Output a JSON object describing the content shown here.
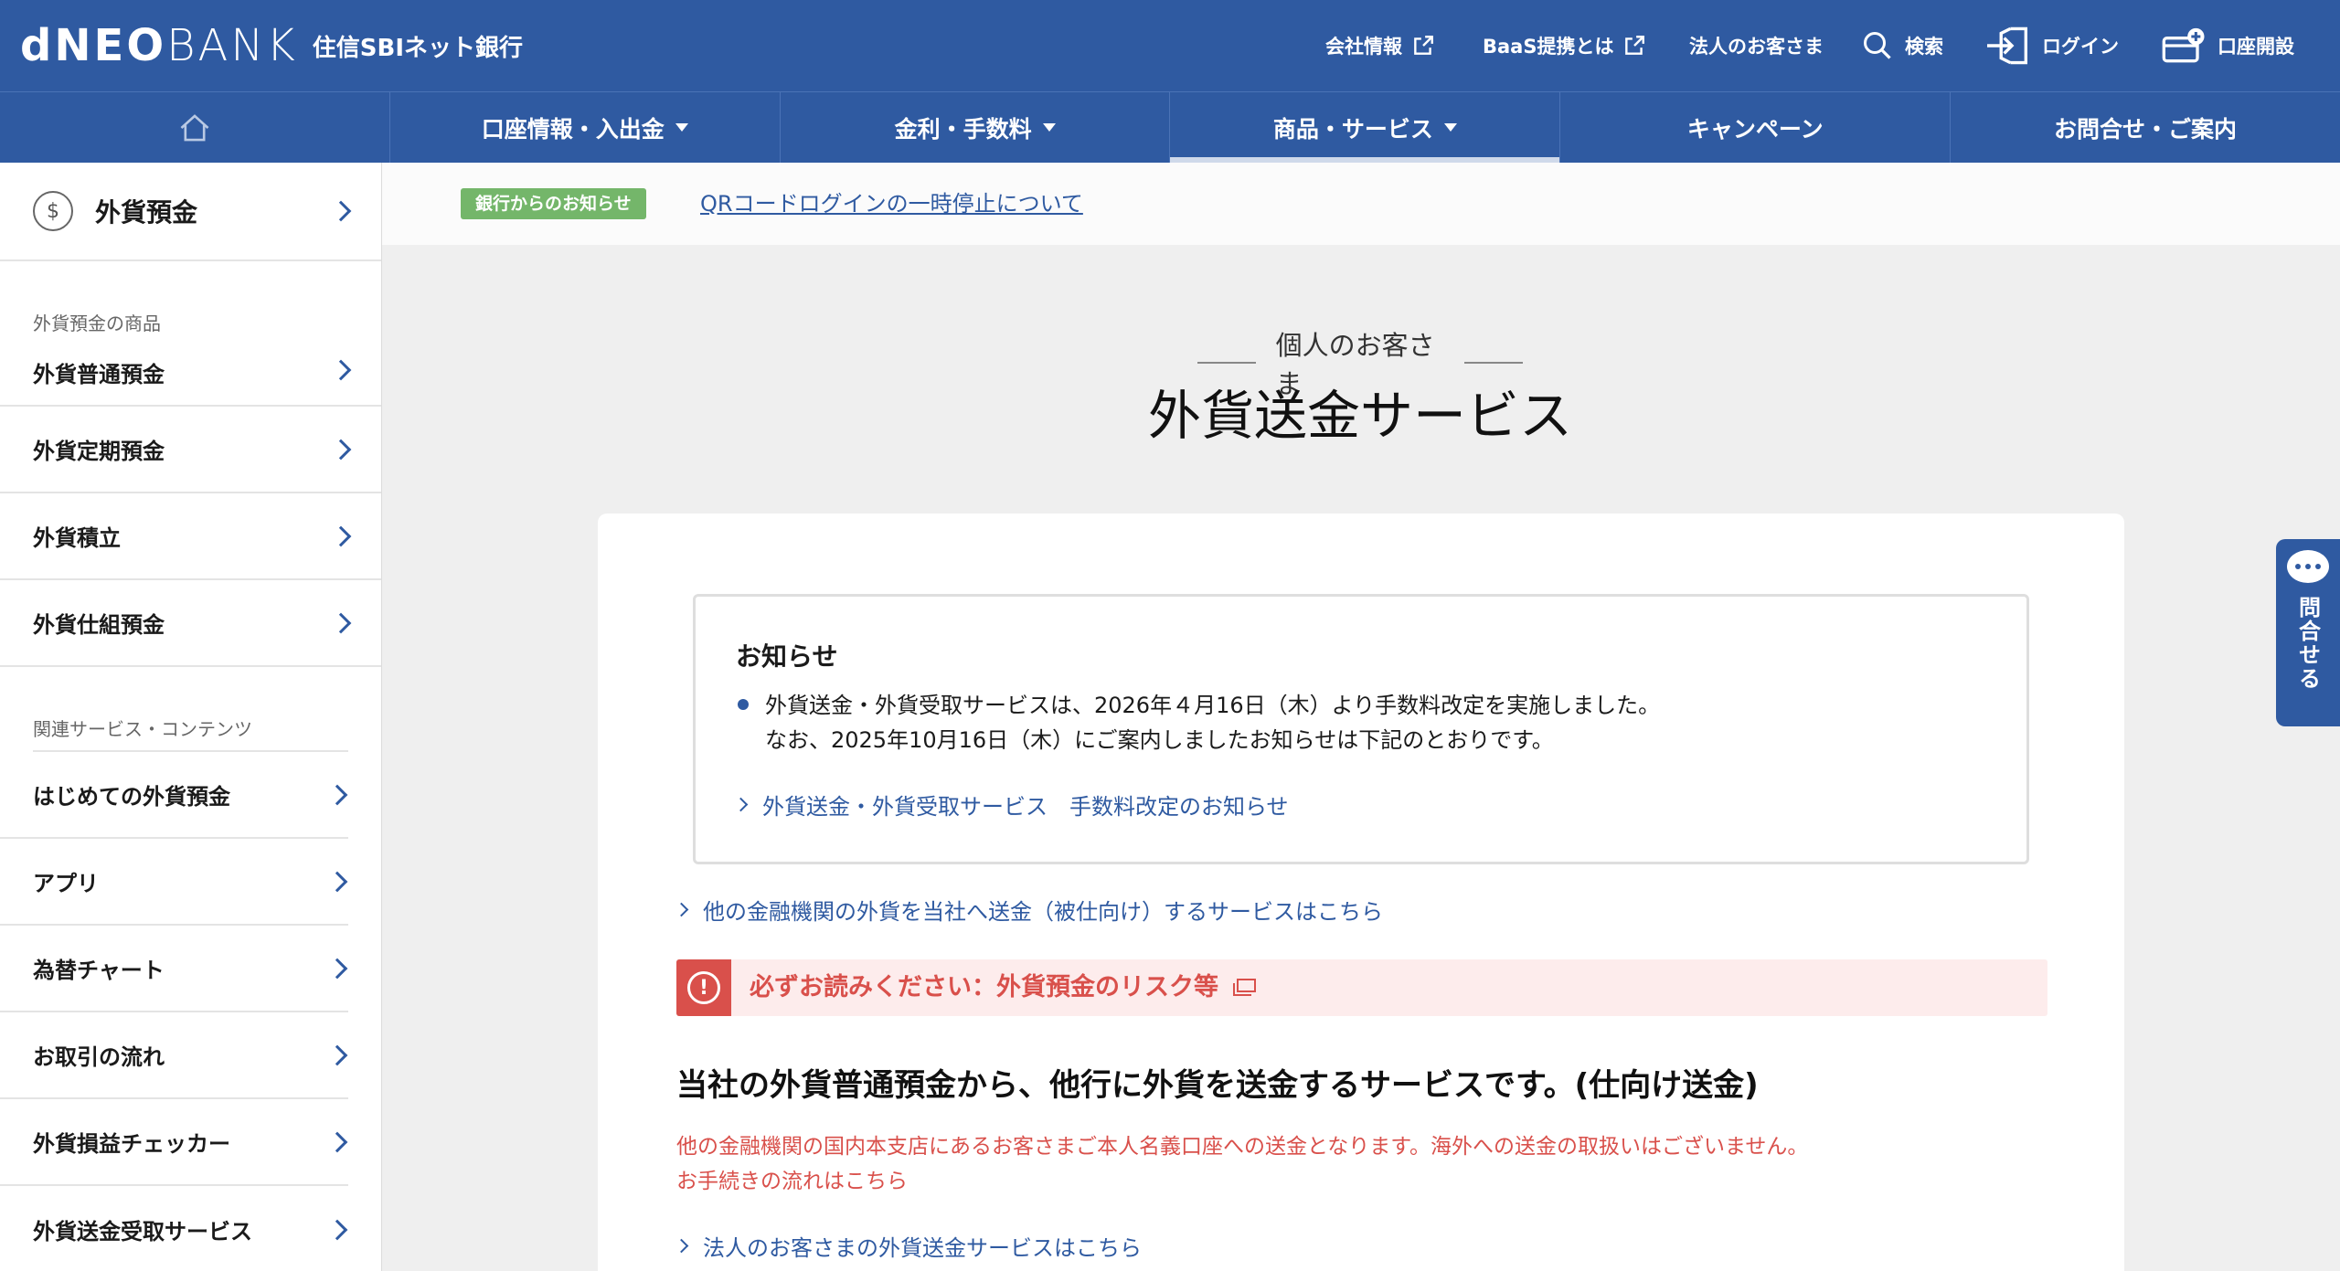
{
  "header": {
    "logo_brand": "NEO",
    "logo_d": "d",
    "logo_bank": "BANK",
    "logo_sub": "住信SBIネット銀行",
    "util": [
      {
        "label": "会社情報",
        "icon": "external-link-icon"
      },
      {
        "label": "BaaS提携とは",
        "icon": "external-link-icon"
      },
      {
        "label": "法人のお客さま"
      },
      {
        "label": "検索",
        "icon": "search-icon"
      },
      {
        "label": "ログイン",
        "icon": "login-icon"
      },
      {
        "label": "口座開設",
        "icon": "card-plus-icon"
      }
    ]
  },
  "nav": {
    "home_icon": "home-icon",
    "items": [
      "口座情報・入出金",
      "金利・手数料",
      "商品・サービス",
      "キャンペーン",
      "お問合せ・ご案内"
    ]
  },
  "sidebar": {
    "head": "外貨預金",
    "coin_symbol": "$",
    "products_caption": "外貨預金の商品",
    "products": [
      "外貨普通預金",
      "外貨定期預金",
      "外貨積立",
      "外貨仕組預金"
    ],
    "related_caption": "関連サービス・コンテンツ",
    "related": [
      "はじめての外貨預金",
      "アプリ",
      "為替チャート",
      "お取引の流れ",
      "外貨損益チェッカー",
      "外貨送金受取サービス"
    ]
  },
  "strip": {
    "tag": "銀行からのお知らせ",
    "link": "QRコードログインの一時停止について"
  },
  "page": {
    "eyebrow": "個人のお客さま",
    "title": "外貨送金サービス"
  },
  "notice": {
    "heading": "お知らせ",
    "line1": "外貨送金・外貨受取サービスは、2026年４月16日（木）より手数料改定を実施しました。",
    "line2": "なお、2025年10月16日（木）にご案内しましたお知らせは下記のとおりです。",
    "link": "外貨送金・外貨受取サービス　手数料改定のお知らせ"
  },
  "content": {
    "link_inbound": "他の金融機関の外貨を当社へ送金（被仕向け）するサービスはこちら",
    "risk": "必ずお読みください：外貨預金のリスク等",
    "heading": "当社の外貨普通預金から、他行に外貨を送金するサービスです。(仕向け送金)",
    "red1": "他の金融機関の国内本支店にあるお客さまご本人名義口座への送金となります。海外への送金の取扱いはございません。",
    "red2": "お手続きの流れはこちら",
    "link_corp": "法人のお客さまの外貨送金サービスはこちら"
  },
  "chat": {
    "label": "問合せる"
  },
  "colors": {
    "brand": "#2f5aa1",
    "alert": "#d9504b",
    "tag": "#74b66a"
  }
}
